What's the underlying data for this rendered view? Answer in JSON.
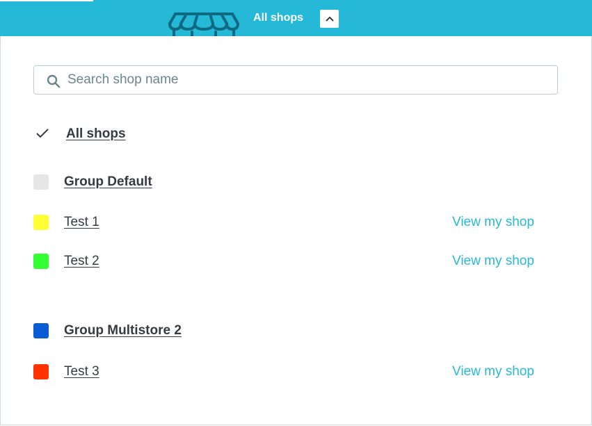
{
  "header": {
    "title": "All shops",
    "store_icon": "storefront-icon",
    "toggle_icon": "chevron-up-icon",
    "background_color": "#25b9d7"
  },
  "search": {
    "placeholder": "Search shop name",
    "value": "",
    "icon": "search-icon"
  },
  "all_shops": {
    "label": "All shops",
    "selected": true,
    "icon": "check-icon"
  },
  "groups": [
    {
      "label": "Group Default",
      "color": "#e6e6e6",
      "shops": [
        {
          "label": "Test 1",
          "color": "#ffff33",
          "link": "View my shop"
        },
        {
          "label": "Test 2",
          "color": "#33ff33",
          "link": "View my shop"
        }
      ]
    },
    {
      "label": "Group Multistore 2",
      "color": "#0a5cd6",
      "shops": [
        {
          "label": "Test 3",
          "color": "#ff3300",
          "link": "View my shop"
        }
      ]
    }
  ],
  "colors": {
    "accent": "#25b9d7",
    "text": "#363a41",
    "border": "#bbcdd2"
  }
}
